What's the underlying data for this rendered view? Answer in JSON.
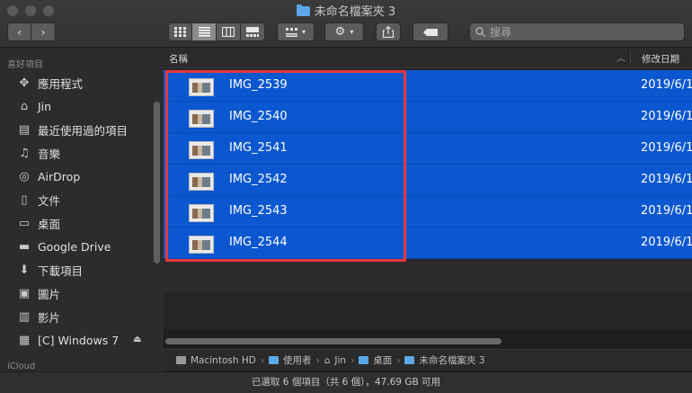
{
  "window": {
    "title": "未命名檔案夾 3"
  },
  "toolbar": {
    "nav_back": "‹",
    "nav_forward": "›",
    "view_modes": [
      "icon-view",
      "list-view",
      "column-view",
      "gallery-view"
    ],
    "search_placeholder": "搜尋"
  },
  "sidebar": {
    "section_favorites": "喜好項目",
    "items": [
      {
        "label": "應用程式",
        "icon": "applications-icon"
      },
      {
        "label": "Jin",
        "icon": "home-icon"
      },
      {
        "label": "最近使用過的項目",
        "icon": "recents-icon"
      },
      {
        "label": "音樂",
        "icon": "music-icon"
      },
      {
        "label": "AirDrop",
        "icon": "airdrop-icon"
      },
      {
        "label": "文件",
        "icon": "documents-icon"
      },
      {
        "label": "桌面",
        "icon": "desktop-icon"
      },
      {
        "label": "Google Drive",
        "icon": "folder-icon"
      },
      {
        "label": "下載項目",
        "icon": "downloads-icon"
      },
      {
        "label": "圖片",
        "icon": "pictures-icon"
      },
      {
        "label": "影片",
        "icon": "movies-icon"
      },
      {
        "label": "[C] Windows 7",
        "icon": "drive-icon"
      }
    ],
    "section_icloud": "iCloud"
  },
  "columns": {
    "name": "名稱",
    "date_modified": "修改日期"
  },
  "files": [
    {
      "name": "IMG_2539",
      "date": "2019/6/1"
    },
    {
      "name": "IMG_2540",
      "date": "2019/6/1"
    },
    {
      "name": "IMG_2541",
      "date": "2019/6/1"
    },
    {
      "name": "IMG_2542",
      "date": "2019/6/1"
    },
    {
      "name": "IMG_2543",
      "date": "2019/6/1"
    },
    {
      "name": "IMG_2544",
      "date": "2019/6/1"
    }
  ],
  "path": [
    "Macintosh HD",
    "使用者",
    "Jin",
    "桌面",
    "未命名檔案夾 3"
  ],
  "status": {
    "text": "已選取 6 個項目（共 6 個），47.69 GB 可用"
  },
  "colors": {
    "selection": "#0b57d0",
    "highlight_box": "#e8373f"
  }
}
